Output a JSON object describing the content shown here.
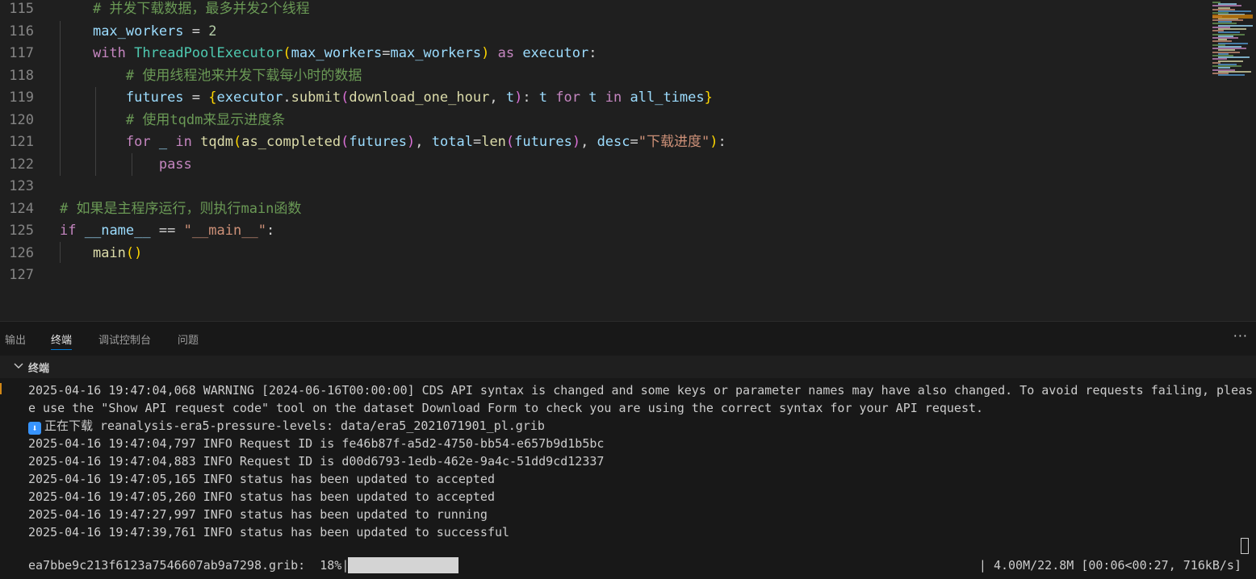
{
  "editor": {
    "lines": [
      {
        "num": "115",
        "tokens": [
          {
            "t": "    ",
            "c": ""
          },
          {
            "t": "# 并发下载数据，最多并发2个线程",
            "c": "c-cm"
          }
        ]
      },
      {
        "num": "116",
        "tokens": [
          {
            "t": "    ",
            "c": ""
          },
          {
            "t": "max_workers",
            "c": "c-var"
          },
          {
            "t": " = ",
            "c": "c-op"
          },
          {
            "t": "2",
            "c": "c-num"
          }
        ]
      },
      {
        "num": "117",
        "tokens": [
          {
            "t": "    ",
            "c": ""
          },
          {
            "t": "with",
            "c": "c-kw"
          },
          {
            "t": " ",
            "c": ""
          },
          {
            "t": "ThreadPoolExecutor",
            "c": "c-cls"
          },
          {
            "t": "(",
            "c": "b1"
          },
          {
            "t": "max_workers",
            "c": "c-var"
          },
          {
            "t": "=",
            "c": "c-op"
          },
          {
            "t": "max_workers",
            "c": "c-var"
          },
          {
            "t": ")",
            "c": "b1"
          },
          {
            "t": " ",
            "c": ""
          },
          {
            "t": "as",
            "c": "c-kw"
          },
          {
            "t": " ",
            "c": ""
          },
          {
            "t": "executor",
            "c": "c-var"
          },
          {
            "t": ":",
            "c": "c-op"
          }
        ]
      },
      {
        "num": "118",
        "tokens": [
          {
            "t": "        ",
            "c": ""
          },
          {
            "t": "# 使用线程池来并发下载每小时的数据",
            "c": "c-cm"
          }
        ]
      },
      {
        "num": "119",
        "tokens": [
          {
            "t": "        ",
            "c": ""
          },
          {
            "t": "futures",
            "c": "c-var"
          },
          {
            "t": " = ",
            "c": "c-op"
          },
          {
            "t": "{",
            "c": "b1"
          },
          {
            "t": "executor",
            "c": "c-var"
          },
          {
            "t": ".",
            "c": "c-op"
          },
          {
            "t": "submit",
            "c": "c-fn"
          },
          {
            "t": "(",
            "c": "b2"
          },
          {
            "t": "download_one_hour",
            "c": "c-fn"
          },
          {
            "t": ", ",
            "c": "c-op"
          },
          {
            "t": "t",
            "c": "c-var"
          },
          {
            "t": ")",
            "c": "b2"
          },
          {
            "t": ": ",
            "c": "c-op"
          },
          {
            "t": "t",
            "c": "c-var"
          },
          {
            "t": " ",
            "c": ""
          },
          {
            "t": "for",
            "c": "c-kw"
          },
          {
            "t": " ",
            "c": ""
          },
          {
            "t": "t",
            "c": "c-var"
          },
          {
            "t": " ",
            "c": ""
          },
          {
            "t": "in",
            "c": "c-kw"
          },
          {
            "t": " ",
            "c": ""
          },
          {
            "t": "all_times",
            "c": "c-var"
          },
          {
            "t": "}",
            "c": "b1"
          }
        ]
      },
      {
        "num": "120",
        "tokens": [
          {
            "t": "        ",
            "c": ""
          },
          {
            "t": "# 使用tqdm来显示进度条",
            "c": "c-cm"
          }
        ]
      },
      {
        "num": "121",
        "tokens": [
          {
            "t": "        ",
            "c": ""
          },
          {
            "t": "for",
            "c": "c-kw"
          },
          {
            "t": " ",
            "c": ""
          },
          {
            "t": "_",
            "c": "c-var"
          },
          {
            "t": " ",
            "c": ""
          },
          {
            "t": "in",
            "c": "c-kw"
          },
          {
            "t": " ",
            "c": ""
          },
          {
            "t": "tqdm",
            "c": "c-fn"
          },
          {
            "t": "(",
            "c": "b1"
          },
          {
            "t": "as_completed",
            "c": "c-fn"
          },
          {
            "t": "(",
            "c": "b2"
          },
          {
            "t": "futures",
            "c": "c-var"
          },
          {
            "t": ")",
            "c": "b2"
          },
          {
            "t": ", ",
            "c": "c-op"
          },
          {
            "t": "total",
            "c": "c-var"
          },
          {
            "t": "=",
            "c": "c-op"
          },
          {
            "t": "len",
            "c": "c-fn"
          },
          {
            "t": "(",
            "c": "b2"
          },
          {
            "t": "futures",
            "c": "c-var"
          },
          {
            "t": ")",
            "c": "b2"
          },
          {
            "t": ", ",
            "c": "c-op"
          },
          {
            "t": "desc",
            "c": "c-var"
          },
          {
            "t": "=",
            "c": "c-op"
          },
          {
            "t": "\"下载进度\"",
            "c": "c-str"
          },
          {
            "t": ")",
            "c": "b1"
          },
          {
            "t": ":",
            "c": "c-op"
          }
        ]
      },
      {
        "num": "122",
        "tokens": [
          {
            "t": "            ",
            "c": ""
          },
          {
            "t": "pass",
            "c": "c-kw"
          }
        ]
      },
      {
        "num": "123",
        "tokens": []
      },
      {
        "num": "124",
        "tokens": [
          {
            "t": "# 如果是主程序运行，则执行main函数",
            "c": "c-cm"
          }
        ]
      },
      {
        "num": "125",
        "tokens": [
          {
            "t": "if",
            "c": "c-kw"
          },
          {
            "t": " ",
            "c": ""
          },
          {
            "t": "__name__",
            "c": "c-var"
          },
          {
            "t": " == ",
            "c": "c-op"
          },
          {
            "t": "\"__main__\"",
            "c": "c-str"
          },
          {
            "t": ":",
            "c": "c-op"
          }
        ]
      },
      {
        "num": "126",
        "tokens": [
          {
            "t": "    ",
            "c": ""
          },
          {
            "t": "main",
            "c": "c-fn"
          },
          {
            "t": "()",
            "c": "b1"
          }
        ]
      },
      {
        "num": "127",
        "tokens": []
      }
    ]
  },
  "panel": {
    "tabs": [
      {
        "label": "输出",
        "active": false
      },
      {
        "label": "终端",
        "active": true
      },
      {
        "label": "调试控制台",
        "active": false
      },
      {
        "label": "问题",
        "active": false
      }
    ],
    "more_label": "···",
    "terminal_title": "终端"
  },
  "terminal": {
    "lines": [
      "2025-04-16 19:47:04,068 WARNING [2024-06-16T00:00:00] CDS API syntax is changed and some keys or parameter names may have also changed. To avoid requests failing, pleas",
      "e use the \"Show API request code\" tool on the dataset Download Form to check you are using the correct syntax for your API request.",
      "正在下载 reanalysis-era5-pressure-levels: data/era5_2021071901_pl.grib",
      "2025-04-16 19:47:04,797 INFO Request ID is fe46b87f-a5d2-4750-bb54-e657b9d1b5bc",
      "2025-04-16 19:47:04,883 INFO Request ID is d00d6793-1edb-462e-9a4c-51dd9cd12337",
      "2025-04-16 19:47:05,165 INFO status has been updated to accepted",
      "2025-04-16 19:47:05,260 INFO status has been updated to accepted",
      "2025-04-16 19:47:27,997 INFO status has been updated to running",
      "2025-04-16 19:47:39,761 INFO status has been updated to successful"
    ],
    "download_icon": "⬇",
    "progress": {
      "label": "ea7bbe9c213f6123a7546607ab9a7298.grib:  18%|",
      "fraction": 0.18,
      "stats": "| 4.00M/22.8M [00:06<00:27, 716kB/s]"
    }
  },
  "colors": {
    "editor_bg": "#1f1f1f",
    "panel_bg": "#181818",
    "accent": "#0078d4",
    "progress_fill": "#d4d4d4"
  }
}
